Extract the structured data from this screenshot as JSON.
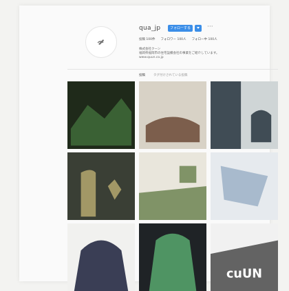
{
  "profile": {
    "username": "qua_jp",
    "follow_label": "フォローする",
    "more_label": "···",
    "stats": [
      "投稿 100件",
      "フォロワー 100人",
      "フォロー中 100人"
    ],
    "bio": [
      "株式会社クーン",
      "福岡県福岡市の住宅設備会社の事業をご紹介しています。",
      "www.quun.co.jp"
    ]
  },
  "tabs": [
    "投稿",
    "タグ付けされている投稿"
  ],
  "posts": [
    {
      "name": "factory-machine",
      "colors": [
        "#1f2a1a",
        "#3f6b3a"
      ]
    },
    {
      "name": "office-meeting",
      "colors": [
        "#d8d2c6",
        "#6c4a36"
      ]
    },
    {
      "name": "cafe-seating",
      "colors": [
        "#cfd5d6",
        "#27343e"
      ]
    },
    {
      "name": "site-inspection",
      "colors": [
        "#3a3f35",
        "#b5a86e"
      ]
    },
    {
      "name": "office-interior",
      "colors": [
        "#e9e6dc",
        "#6d8452"
      ]
    },
    {
      "name": "sheet-material",
      "colors": [
        "#e6eaee",
        "#9cb2c7"
      ]
    },
    {
      "name": "portrait-man",
      "colors": [
        "#f1f1ef",
        "#1a1f3a"
      ]
    },
    {
      "name": "portrait-worker",
      "colors": [
        "#1f2326",
        "#58a86f"
      ]
    },
    {
      "name": "building-logo",
      "colors": [
        "#f1f1f1",
        "#4a4a4a"
      ],
      "text": "cuUN"
    }
  ]
}
